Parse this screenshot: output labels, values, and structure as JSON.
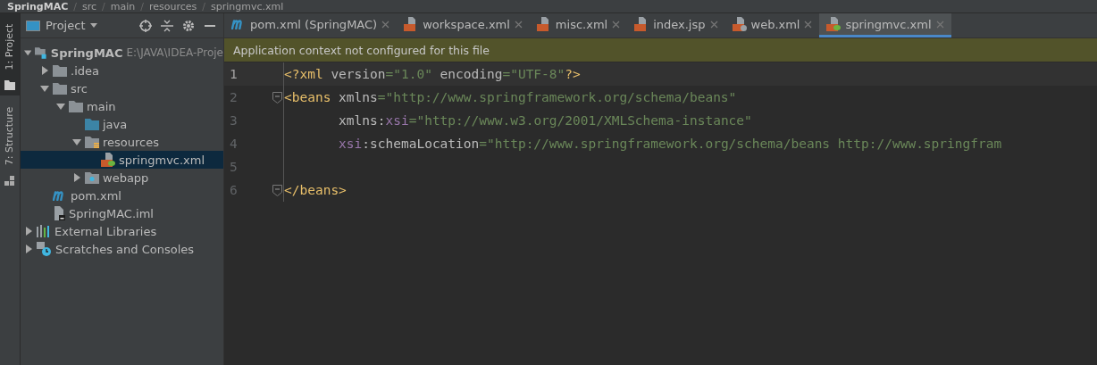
{
  "breadcrumb": {
    "separator": "/",
    "items": [
      "SpringMAC",
      "src",
      "main",
      "resources",
      "springmvc.xml"
    ]
  },
  "side_stripe": [
    {
      "label": "1: Project",
      "selected": true
    },
    {
      "label": "7: Structure",
      "selected": false
    }
  ],
  "project_panel": {
    "title": "Project",
    "tree": [
      {
        "label": "SpringMAC",
        "path": "E:\\JAVA\\IDEA-Proje",
        "kind": "module",
        "expanded": true,
        "selected": false,
        "children": [
          {
            "label": ".idea",
            "kind": "folder",
            "expanded": false,
            "selected": false
          },
          {
            "label": "src",
            "kind": "folder",
            "expanded": true,
            "selected": false,
            "children": [
              {
                "label": "main",
                "kind": "folder",
                "expanded": true,
                "selected": false,
                "children": [
                  {
                    "label": "java",
                    "kind": "source",
                    "selected": false
                  },
                  {
                    "label": "resources",
                    "kind": "resources",
                    "expanded": true,
                    "selected": false,
                    "children": [
                      {
                        "label": "springmvc.xml",
                        "kind": "spring",
                        "selected": true
                      }
                    ]
                  },
                  {
                    "label": "webapp",
                    "kind": "web",
                    "expanded": false,
                    "selected": false
                  }
                ]
              }
            ]
          },
          {
            "label": "pom.xml",
            "kind": "maven",
            "selected": false
          },
          {
            "label": "SpringMAC.iml",
            "kind": "iml",
            "selected": false
          }
        ]
      },
      {
        "label": "External Libraries",
        "kind": "libraries",
        "expanded": false,
        "selected": false
      },
      {
        "label": "Scratches and Consoles",
        "kind": "scratches",
        "expanded": false,
        "selected": false
      }
    ]
  },
  "tabs": [
    {
      "label": "pom.xml (SpringMAC)",
      "kind": "maven",
      "selected": false
    },
    {
      "label": "workspace.xml",
      "kind": "xml",
      "selected": false
    },
    {
      "label": "misc.xml",
      "kind": "xml",
      "selected": false
    },
    {
      "label": "index.jsp",
      "kind": "jsp",
      "selected": false
    },
    {
      "label": "web.xml",
      "kind": "webxml",
      "selected": false
    },
    {
      "label": "springmvc.xml",
      "kind": "spring",
      "selected": true
    }
  ],
  "banner": "Application context not configured for this file",
  "code_lines": [
    {
      "number": "1",
      "current": true,
      "fold": false,
      "tokens": [
        {
          "kind": "tag",
          "text": "<?xml "
        },
        {
          "kind": "attr",
          "text": "version"
        },
        {
          "kind": "value",
          "text": "=\"1.0\" "
        },
        {
          "kind": "attr",
          "text": "encoding"
        },
        {
          "kind": "value",
          "text": "=\"UTF-8\""
        },
        {
          "kind": "tag",
          "text": "?>"
        }
      ]
    },
    {
      "number": "2",
      "current": false,
      "fold": true,
      "tokens": [
        {
          "kind": "tag",
          "text": "<beans "
        },
        {
          "kind": "attr",
          "text": "xmlns"
        },
        {
          "kind": "value",
          "text": "=\"http://www.springframework.org/schema/beans\""
        }
      ]
    },
    {
      "number": "3",
      "current": false,
      "fold": false,
      "tokens": [
        {
          "kind": "attr",
          "text": "       xmlns:"
        },
        {
          "kind": "ns",
          "text": "xsi"
        },
        {
          "kind": "value",
          "text": "=\"http://www.w3.org/2001/XMLSchema-instance\""
        }
      ]
    },
    {
      "number": "4",
      "current": false,
      "fold": false,
      "tokens": [
        {
          "kind": "ns",
          "text": "       xsi"
        },
        {
          "kind": "attr",
          "text": ":schemaLocation"
        },
        {
          "kind": "value",
          "text": "=\"http://www.springframework.org/schema/beans http://www.springfram"
        }
      ]
    },
    {
      "number": "5",
      "current": false,
      "fold": false
    },
    {
      "number": "6",
      "current": false,
      "fold": true,
      "tokens": [
        {
          "kind": "tag",
          "text": "</beans>"
        }
      ]
    }
  ]
}
